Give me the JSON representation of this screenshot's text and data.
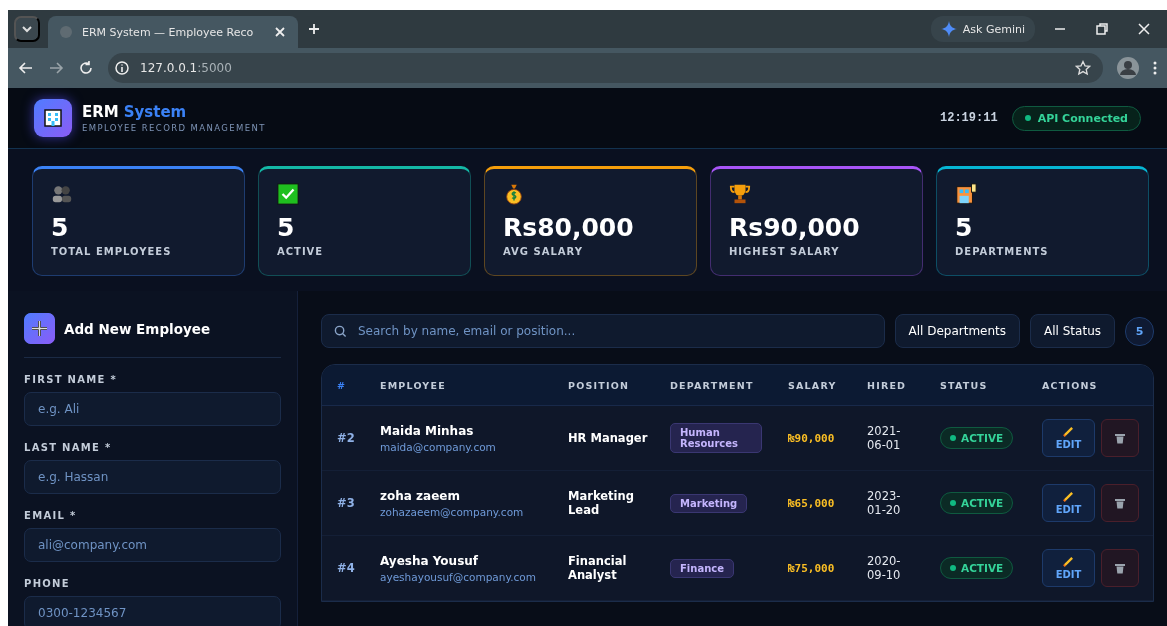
{
  "browser": {
    "tab_title": "ERM System — Employee Reco",
    "ask_label": "Ask Gemini",
    "url_host": "127.0.0.1",
    "url_port": ":5000"
  },
  "header": {
    "logo_title": "ERM",
    "logo_accent": "System",
    "subtitle": "EMPLOYEE RECORD MANAGEMENT",
    "clock": "12:19:11",
    "api_status": "API Connected"
  },
  "stats": [
    {
      "kind": "people",
      "value": "5",
      "label": "TOTAL EMPLOYEES",
      "color": "#3b82f6"
    },
    {
      "kind": "check",
      "value": "5",
      "label": "ACTIVE",
      "color": "#14b8a6"
    },
    {
      "kind": "money",
      "value": "Rs80,000",
      "label": "AVG SALARY",
      "color": "#f59e0b"
    },
    {
      "kind": "trophy",
      "value": "Rs90,000",
      "label": "HIGHEST SALARY",
      "color": "#a855f7"
    },
    {
      "kind": "building",
      "value": "5",
      "label": "DEPARTMENTS",
      "color": "#06b6d4"
    }
  ],
  "form": {
    "title": "Add New Employee",
    "fields": [
      {
        "label": "FIRST NAME *",
        "placeholder": "e.g. Ali"
      },
      {
        "label": "LAST NAME *",
        "placeholder": "e.g. Hassan"
      },
      {
        "label": "EMAIL *",
        "placeholder": "ali@company.com"
      },
      {
        "label": "PHONE",
        "placeholder": "0300-1234567"
      }
    ]
  },
  "toolbar": {
    "search_placeholder": "Search by name, email or position...",
    "department_filter": "All Departments",
    "status_filter": "All Status",
    "count": "5"
  },
  "table": {
    "columns": [
      "#",
      "EMPLOYEE",
      "POSITION",
      "DEPARTMENT",
      "SALARY",
      "HIRED",
      "STATUS",
      "ACTIONS"
    ],
    "rows": [
      {
        "id": "#2",
        "name": "Maida Minhas",
        "email": "maida@company.com",
        "position": "HR Manager",
        "department": "Human Resources",
        "salary": "₨90,000",
        "hired": "2021-06-01",
        "status": "ACTIVE",
        "edit": "EDIT"
      },
      {
        "id": "#3",
        "name": "zoha zaeem",
        "email": "zohazaeem@company.com",
        "position": "Marketing Lead",
        "department": "Marketing",
        "salary": "₨65,000",
        "hired": "2023-01-20",
        "status": "ACTIVE",
        "edit": "EDIT"
      },
      {
        "id": "#4",
        "name": "Ayesha Yousuf",
        "email": "ayeshayousuf@company.com",
        "position": "Financial Analyst",
        "department": "Finance",
        "salary": "₨75,000",
        "hired": "2020-09-10",
        "status": "ACTIVE",
        "edit": "EDIT"
      }
    ]
  }
}
